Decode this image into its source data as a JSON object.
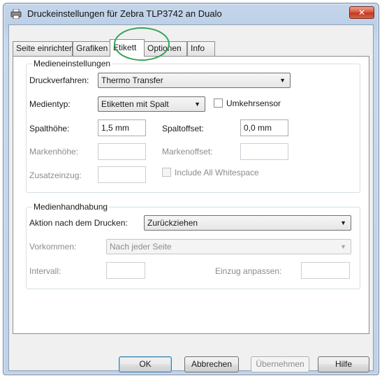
{
  "window": {
    "title": "Druckeinstellungen für Zebra TLP3742 an Dualo",
    "close_label": "✕"
  },
  "tabs": [
    {
      "label": "Seite einrichten"
    },
    {
      "label": "Grafiken"
    },
    {
      "label": "Etikett",
      "active": true
    },
    {
      "label": "Optionen"
    },
    {
      "label": "Info"
    }
  ],
  "media_settings": {
    "title": "Medieneinstellungen",
    "print_method_label": "Druckverfahren:",
    "print_method_value": "Thermo Transfer",
    "media_type_label": "Medientyp:",
    "media_type_value": "Etiketten mit Spalt",
    "reverse_sensor_label": "Umkehrsensor",
    "gap_height_label": "Spalthöhe:",
    "gap_height_value": "1,5 mm",
    "gap_offset_label": "Spaltoffset:",
    "gap_offset_value": "0,0 mm",
    "mark_height_label": "Markenhöhe:",
    "mark_height_value": "",
    "mark_offset_label": "Markenoffset:",
    "mark_offset_value": "",
    "extra_feed_label": "Zusatzeinzug:",
    "extra_feed_value": "",
    "include_whitespace_label": "Include All Whitespace"
  },
  "media_handling": {
    "title": "Medienhandhabung",
    "action_label": "Aktion nach dem Drucken:",
    "action_value": "Zurückziehen",
    "occurrence_label": "Vorkommen:",
    "occurrence_value": "Nach jeder Seite",
    "interval_label": "Intervall:",
    "interval_value": "",
    "feed_adjust_label": "Einzug anpassen:",
    "feed_adjust_value": ""
  },
  "buttons": {
    "ok": "OK",
    "cancel": "Abbrechen",
    "apply": "Übernehmen",
    "help": "Hilfe"
  },
  "colors": {
    "highlight_circle": "#33a35a",
    "close_button": "#c23a20"
  },
  "icons": {
    "title": "printer-icon",
    "dropdown": "chevron-down-icon"
  }
}
